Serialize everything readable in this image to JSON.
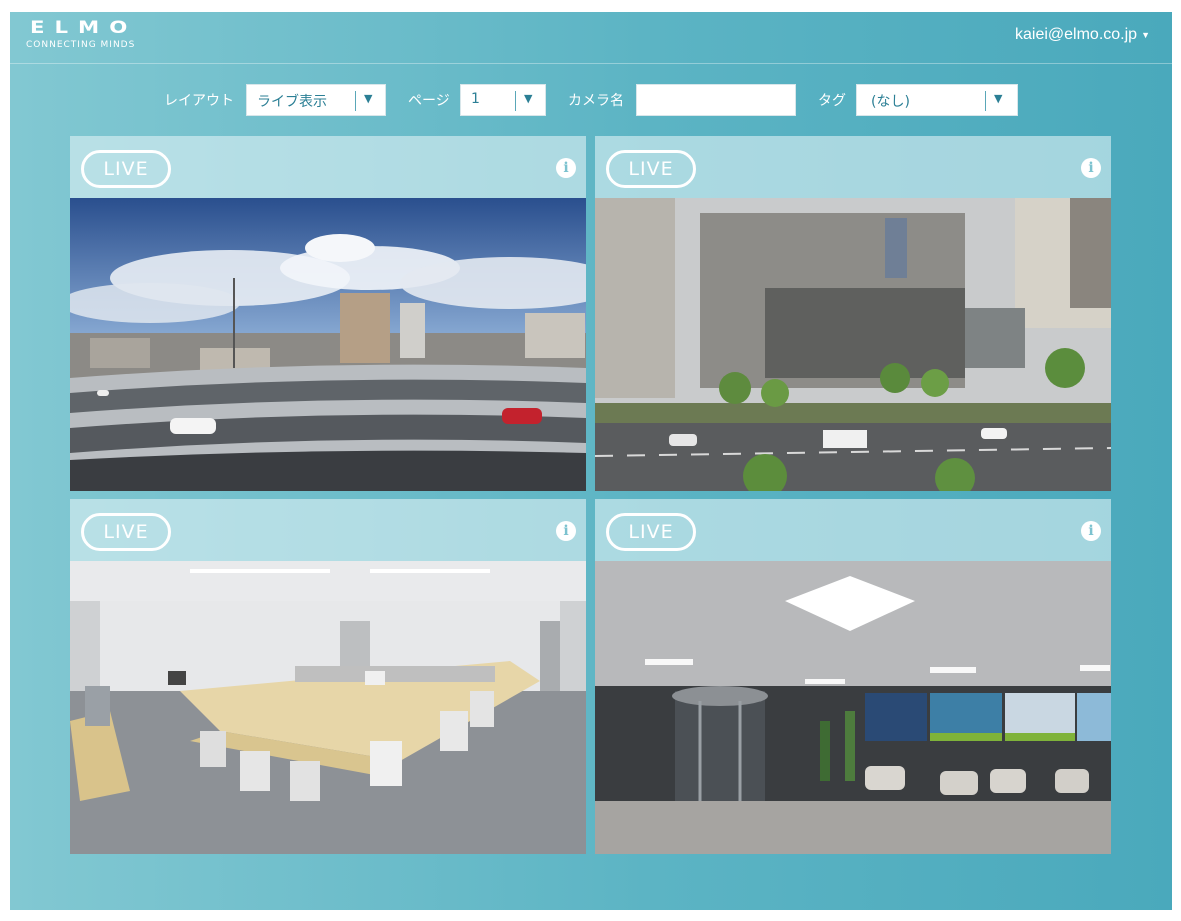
{
  "header": {
    "logo_text": "ELMO",
    "logo_tagline": "CONNECTING MINDS",
    "user_email": "kaiei@elmo.co.jp"
  },
  "filters": {
    "layout_label": "レイアウト",
    "layout_value": "ライブ表示",
    "page_label": "ページ",
    "page_value": "1",
    "camera_name_label": "カメラ名",
    "camera_name_value": "",
    "tag_label": "タグ",
    "tag_value": "(なし)"
  },
  "cameras": [
    {
      "badge": "LIVE",
      "scene": "elevated-highway-city-view"
    },
    {
      "badge": "LIVE",
      "scene": "office-building-street-view"
    },
    {
      "badge": "LIVE",
      "scene": "meeting-room-view"
    },
    {
      "badge": "LIVE",
      "scene": "lobby-revolving-door-view"
    }
  ],
  "colors": {
    "background_light": "#82c8d2",
    "background_dark": "#4aa9bc",
    "accent_text": "#2b7f95"
  },
  "icons": {
    "info": "info-icon",
    "dropdown": "caret-down-icon"
  }
}
